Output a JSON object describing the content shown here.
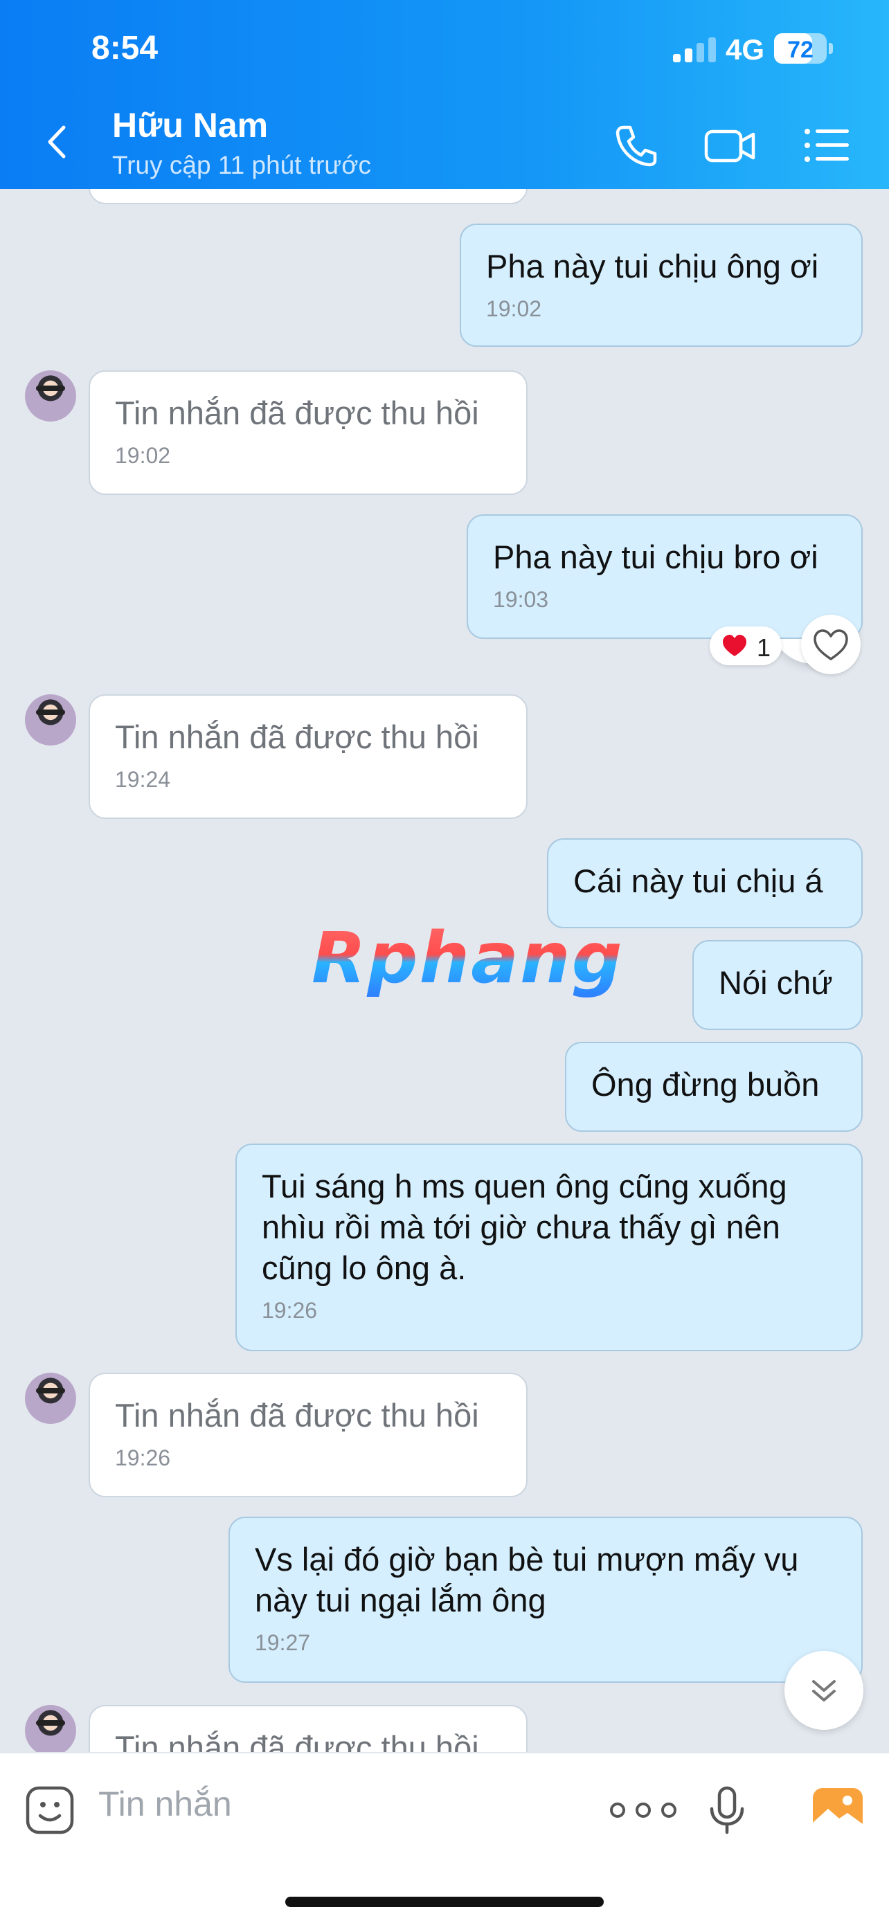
{
  "status_bar": {
    "time": "8:54",
    "network": "4G",
    "battery": "72",
    "battery_level": 0.72
  },
  "header": {
    "contact_name": "Hữu Nam",
    "contact_status": "Truy cập 11 phút trước"
  },
  "messages": [
    {
      "dir": "out",
      "text": "Pha này tui chịu ông ơi",
      "time": "19:02"
    },
    {
      "dir": "in",
      "text": "Tin nhắn đã được thu hồi",
      "time": "19:02"
    },
    {
      "dir": "out",
      "text": "Pha này tui chịu bro ơi",
      "time": "19:03",
      "reaction": {
        "emoji": "heart",
        "count": "1"
      }
    },
    {
      "dir": "in",
      "text": "Tin nhắn đã được thu hồi",
      "time": "19:24"
    },
    {
      "dir": "out",
      "text": "Cái này tui chịu á"
    },
    {
      "dir": "out",
      "text": "Nói chứ"
    },
    {
      "dir": "out",
      "text": "Ông đừng buồn"
    },
    {
      "dir": "out",
      "text": "Tui sáng h ms quen ông cũng xuống\nnhìu rồi mà tới giờ chưa thấy gì nên\ncũng lo ông à.",
      "time": "19:26"
    },
    {
      "dir": "in",
      "text": "Tin nhắn đã được thu hồi",
      "time": "19:26"
    },
    {
      "dir": "out",
      "text": "Vs lại đó giờ bạn bè tui mượn mấy vụ\nnày tui ngại lắm ông",
      "time": "19:27"
    },
    {
      "dir": "in",
      "text": "Tin nhắn đã được thu hồi"
    }
  ],
  "watermark": "Rphang",
  "input": {
    "placeholder": "Tin nhắn"
  },
  "icons": {
    "back": "chevron-left-icon",
    "call": "phone-icon",
    "video": "video-camera-icon",
    "menu": "list-icon",
    "emoji": "sticker-icon",
    "more": "more-dots-icon",
    "mic": "microphone-icon",
    "image": "image-icon",
    "scroll": "chevron-double-down-icon",
    "reaction": "heart-icon"
  },
  "colors": {
    "header_start": "#0a7df4",
    "header_end": "#27b6fa",
    "outgoing_bubble": "#d5efff",
    "incoming_bubble": "#ffffff",
    "heart": "#e8102e"
  }
}
